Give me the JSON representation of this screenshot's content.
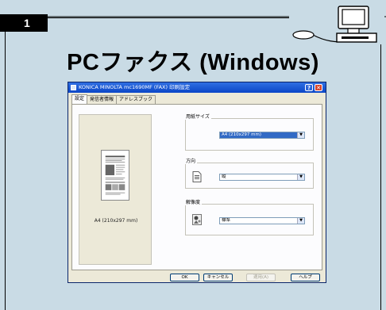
{
  "page": {
    "chapter_number": "1",
    "heading": "PCファクス (Windows)"
  },
  "dialog": {
    "title": "KONICA MINOLTA mc1690MF (FAX) 印刷設定",
    "help_button": "?",
    "close_button": "✕",
    "tabs": [
      {
        "label": "設定",
        "active": true
      },
      {
        "label": "発信者情報",
        "active": false
      },
      {
        "label": "アドレスブック",
        "active": false
      }
    ],
    "preview": {
      "caption": "A4 (210x297 mm)"
    },
    "paper_size": {
      "label": "用紙サイズ",
      "value": "A4 (210x297 mm)"
    },
    "orientation": {
      "label": "方向",
      "value": "縦"
    },
    "resolution": {
      "label": "解像度",
      "value": "標準"
    },
    "buttons": {
      "ok": "OK",
      "cancel": "キャンセル",
      "apply": "適用(A)",
      "help": "ヘルプ"
    }
  },
  "colors": {
    "background": "#c9dbe5",
    "titlebar": "#0b46c7",
    "selection": "#316ac5"
  }
}
